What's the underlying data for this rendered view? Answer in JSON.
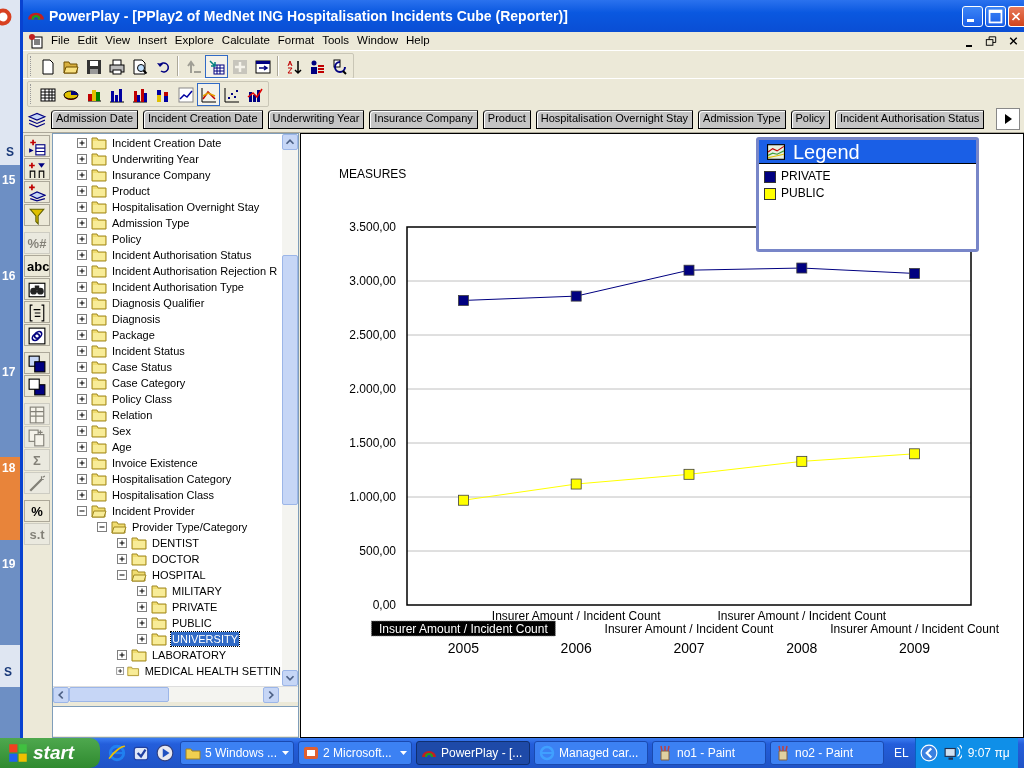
{
  "background_window": {
    "tab": "S",
    "days": [
      {
        "text": "15",
        "highlighted": false
      },
      {
        "text": "16",
        "highlighted": false
      },
      {
        "text": "17",
        "highlighted": false
      },
      {
        "text": "18",
        "highlighted": true
      },
      {
        "text": "19",
        "highlighted": false
      }
    ],
    "bottom_tab": "S"
  },
  "window": {
    "title": "PowerPlay - [PPlay2 of MedNet ING Hospitalisation Incidents Cube (Reporter)]"
  },
  "menu": [
    "File",
    "Edit",
    "View",
    "Insert",
    "Explore",
    "Calculate",
    "Format",
    "Tools",
    "Window",
    "Help"
  ],
  "toolbar_1": [
    [
      {
        "kind": "new",
        "pressed": false,
        "disabled": false
      },
      {
        "kind": "open",
        "pressed": false,
        "disabled": false
      },
      {
        "kind": "save",
        "pressed": false,
        "disabled": false
      },
      {
        "kind": "print",
        "pressed": false,
        "disabled": false
      },
      {
        "kind": "preview",
        "pressed": false,
        "disabled": false
      },
      {
        "kind": "undo",
        "pressed": false,
        "disabled": false
      }
    ],
    [
      {
        "kind": "drill_up",
        "pressed": false,
        "disabled": true
      },
      {
        "kind": "drill_down",
        "pressed": true,
        "disabled": false
      },
      {
        "kind": "add",
        "pressed": false,
        "disabled": true
      },
      {
        "kind": "swap",
        "pressed": false,
        "disabled": false
      }
    ],
    [
      {
        "kind": "sort",
        "pressed": false,
        "disabled": false
      },
      {
        "kind": "rank",
        "pressed": false,
        "disabled": false
      },
      {
        "kind": "explain",
        "pressed": false,
        "disabled": false
      }
    ]
  ],
  "toolbar_2": [
    [
      {
        "kind": "crosstab",
        "pressed": false,
        "disabled": false
      },
      {
        "kind": "pie",
        "pressed": false,
        "disabled": false
      },
      {
        "kind": "bar3d",
        "pressed": false,
        "disabled": false
      },
      {
        "kind": "bar",
        "pressed": false,
        "disabled": false
      },
      {
        "kind": "cluster",
        "pressed": false,
        "disabled": false
      },
      {
        "kind": "stacked",
        "pressed": false,
        "disabled": false
      },
      {
        "kind": "line",
        "pressed": false,
        "disabled": false
      },
      {
        "kind": "multiline",
        "pressed": true,
        "disabled": false
      },
      {
        "kind": "scatter",
        "pressed": false,
        "disabled": false
      },
      {
        "kind": "combo",
        "pressed": false,
        "disabled": false
      }
    ]
  ],
  "dimension_bar": [
    "Admission Date",
    "Incident Creation Date",
    "Underwriting Year",
    "Insurance Company",
    "Product",
    "Hospitalisation Overnight Stay",
    "Admission Type",
    "Policy",
    "Incident Authorisation Status"
  ],
  "side_toolbar": [
    {
      "kind": "nest_rows",
      "disabled": false
    },
    {
      "kind": "nest_cols",
      "disabled": false
    },
    {
      "kind": "nest_layers",
      "disabled": false
    },
    {
      "kind": "filter",
      "disabled": false
    },
    {
      "kind": "text",
      "label": "%#",
      "disabled": true
    },
    {
      "kind": "text",
      "label": "abc",
      "disabled": false
    },
    {
      "kind": "binoculars",
      "disabled": false
    },
    {
      "kind": "bracket",
      "disabled": false
    },
    {
      "kind": "link",
      "disabled": false
    },
    {
      "kind": "front",
      "disabled": false
    },
    {
      "kind": "back",
      "disabled": false
    },
    {
      "kind": "table",
      "disabled": true
    },
    {
      "kind": "copy",
      "disabled": true
    },
    {
      "kind": "text",
      "label": "Σ",
      "disabled": true
    },
    {
      "kind": "wand",
      "disabled": true
    },
    {
      "kind": "text",
      "label": "%",
      "disabled": false
    },
    {
      "kind": "text",
      "label": "s.t",
      "disabled": true
    }
  ],
  "tree": {
    "items": [
      {
        "label": "Incident Creation Date",
        "expanded": false,
        "selected": false
      },
      {
        "label": "Underwriting Year",
        "expanded": false,
        "selected": false
      },
      {
        "label": "Insurance Company",
        "expanded": false,
        "selected": false
      },
      {
        "label": "Product",
        "expanded": false,
        "selected": false
      },
      {
        "label": "Hospitalisation Overnight Stay",
        "expanded": false,
        "selected": false
      },
      {
        "label": "Admission Type",
        "expanded": false,
        "selected": false
      },
      {
        "label": "Policy",
        "expanded": false,
        "selected": false
      },
      {
        "label": "Incident Authorisation Status",
        "expanded": false,
        "selected": false
      },
      {
        "label": "Incident Authorisation Rejection R",
        "expanded": false,
        "selected": false
      },
      {
        "label": "Incident Authorisation Type",
        "expanded": false,
        "selected": false
      },
      {
        "label": "Diagnosis Qualifier",
        "expanded": false,
        "selected": false
      },
      {
        "label": "Diagnosis",
        "expanded": false,
        "selected": false
      },
      {
        "label": "Package",
        "expanded": false,
        "selected": false
      },
      {
        "label": "Incident Status",
        "expanded": false,
        "selected": false
      },
      {
        "label": "Case Status",
        "expanded": false,
        "selected": false
      },
      {
        "label": "Case Category",
        "expanded": false,
        "selected": false
      },
      {
        "label": "Policy Class",
        "expanded": false,
        "selected": false
      },
      {
        "label": "Relation",
        "expanded": false,
        "selected": false
      },
      {
        "label": "Sex",
        "expanded": false,
        "selected": false
      },
      {
        "label": "Age",
        "expanded": false,
        "selected": false
      },
      {
        "label": "Invoice Existence",
        "expanded": false,
        "selected": false
      },
      {
        "label": "Hospitalisation Category",
        "expanded": false,
        "selected": false
      },
      {
        "label": "Hospitalisation Class",
        "expanded": false,
        "selected": false
      },
      {
        "label": "Incident Provider",
        "expanded": true,
        "selected": false,
        "children": [
          {
            "label": "Provider Type/Category",
            "expanded": true,
            "selected": false,
            "children": [
              {
                "label": "DENTIST",
                "expanded": false,
                "selected": false
              },
              {
                "label": "DOCTOR",
                "expanded": false,
                "selected": false
              },
              {
                "label": "HOSPITAL",
                "expanded": true,
                "selected": false,
                "children": [
                  {
                    "label": "MILITARY",
                    "expanded": false,
                    "selected": false
                  },
                  {
                    "label": "PRIVATE",
                    "expanded": false,
                    "selected": false
                  },
                  {
                    "label": "PUBLIC",
                    "expanded": false,
                    "selected": false
                  },
                  {
                    "label": "UNIVERSITY",
                    "expanded": false,
                    "selected": true
                  }
                ]
              },
              {
                "label": "LABORATORY",
                "expanded": false,
                "selected": false
              },
              {
                "label": "MEDICAL HEALTH SETTIN",
                "expanded": false,
                "selected": false
              }
            ]
          }
        ]
      }
    ]
  },
  "chart": {
    "chart_data": {
      "type": "line",
      "ylabel": "MEASURES",
      "grid": true,
      "categories": [
        "2005",
        "2006",
        "2007",
        "2008",
        "2009"
      ],
      "series": [
        {
          "name": "PRIVATE",
          "color": "#000080",
          "marker": "square",
          "values": [
            2820,
            2860,
            3100,
            3120,
            3070
          ]
        },
        {
          "name": "PUBLIC",
          "color": "#ffff00",
          "marker": "square",
          "values": [
            970,
            1120,
            1210,
            1330,
            1400
          ]
        }
      ],
      "ylim": [
        0,
        3500
      ],
      "yticks": [
        {
          "value": 0,
          "label": "0,00"
        },
        {
          "value": 500,
          "label": "500,00"
        },
        {
          "value": 1000,
          "label": "1.000,00"
        },
        {
          "value": 1500,
          "label": "1.500,00"
        },
        {
          "value": 2000,
          "label": "2.000,00"
        },
        {
          "value": 2500,
          "label": "2.500,00"
        },
        {
          "value": 3000,
          "label": "3.000,00"
        },
        {
          "value": 3500,
          "label": "3.500,00"
        }
      ]
    },
    "axis_labels": [
      {
        "text": "Insurer Amount / Incident Count",
        "selected": true
      },
      {
        "text": "Insurer Amount / Incident Count",
        "selected": false
      },
      {
        "text": "Insurer Amount / Incident Count",
        "selected": false
      },
      {
        "text": "Insurer Amount / Incident Count",
        "selected": false
      },
      {
        "text": "Insurer Amount / Incident Count",
        "selected": false
      }
    ]
  },
  "legend": {
    "title": "Legend"
  },
  "taskbar": {
    "start": "start",
    "tasks": [
      {
        "kind": "folder",
        "label": "5 Windows ...",
        "grouped": true,
        "active": false
      },
      {
        "kind": "presentation",
        "label": "2 Microsoft...",
        "grouped": true,
        "active": false
      },
      {
        "kind": "powerplay",
        "label": "PowerPlay - [...",
        "grouped": false,
        "active": true
      },
      {
        "kind": "browser",
        "label": "Managed car...",
        "grouped": false,
        "active": false
      },
      {
        "kind": "paint",
        "label": "no1 - Paint",
        "grouped": false,
        "active": false
      },
      {
        "kind": "paint",
        "label": "no2 - Paint",
        "grouped": false,
        "active": false
      }
    ],
    "language": "EL",
    "clock": "9:07 πμ"
  }
}
